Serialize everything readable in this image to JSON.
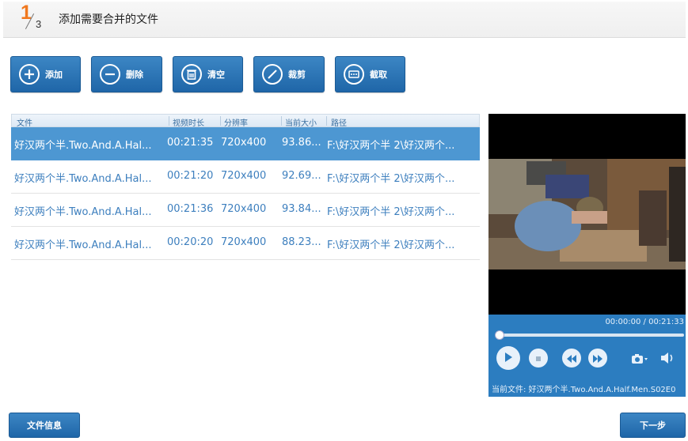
{
  "header": {
    "step_current": "1",
    "step_total": "3",
    "title": "添加需要合并的文件"
  },
  "toolbar": {
    "add": {
      "label": "添加",
      "icon": "plus-circle-icon"
    },
    "delete": {
      "label": "删除",
      "icon": "minus-circle-icon"
    },
    "clear": {
      "label": "清空",
      "icon": "trash-icon"
    },
    "clip": {
      "label": "裁剪",
      "icon": "slash-circle-icon"
    },
    "capture": {
      "label": "截取",
      "icon": "film-circle-icon"
    }
  },
  "table": {
    "columns": [
      "文件",
      "视频时长",
      "分辨率",
      "当前大小",
      "路径"
    ],
    "rows": [
      {
        "file": "好汉两个半.Two.And.A.Hal...",
        "duration": "00:21:35",
        "resolution": "720x400",
        "size": "93.86...",
        "path": "F:\\好汉两个半 2\\好汉两个...",
        "selected": true
      },
      {
        "file": "好汉两个半.Two.And.A.Hal...",
        "duration": "00:21:20",
        "resolution": "720x400",
        "size": "92.69...",
        "path": "F:\\好汉两个半 2\\好汉两个...",
        "selected": false
      },
      {
        "file": "好汉两个半.Two.And.A.Hal...",
        "duration": "00:21:36",
        "resolution": "720x400",
        "size": "93.84...",
        "path": "F:\\好汉两个半 2\\好汉两个...",
        "selected": false
      },
      {
        "file": "好汉两个半.Two.And.A.Hal...",
        "duration": "00:20:20",
        "resolution": "720x400",
        "size": "88.23...",
        "path": "F:\\好汉两个半 2\\好汉两个...",
        "selected": false
      }
    ]
  },
  "player": {
    "time": "00:00:00 / 00:21:33",
    "progress": 0,
    "current_file": "当前文件: 好汉两个半.Two.And.A.Half.Men.S02E0",
    "icons": [
      "play-icon",
      "stop-icon",
      "rewind-icon",
      "fast-forward-icon",
      "camera-icon",
      "volume-icon"
    ]
  },
  "footer": {
    "file_info": "文件信息",
    "next": "下一步"
  },
  "colors": {
    "accent": "#2c7dc0",
    "step_orange": "#f0781e",
    "selected_row": "#4d97d2",
    "row_text": "#3d7fbe"
  }
}
